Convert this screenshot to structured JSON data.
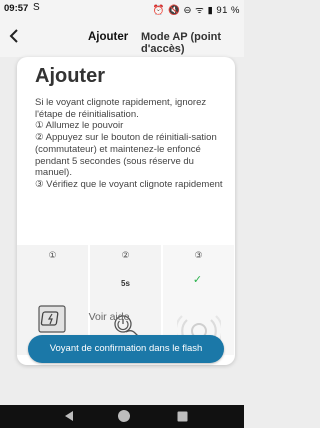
{
  "status_bar": {
    "time": "09:57",
    "app_glyph": "S",
    "system_icons": "⏰ 🔇 ⊖ ᯤ ▮ 91 %"
  },
  "header": {
    "title": "Ajouter",
    "mode_tab": "Mode AP (point d'accès)"
  },
  "card": {
    "title": "Ajouter",
    "instructions": [
      "Si le voyant clignote rapidement, ignorez l'étape de réinitialisation.",
      "① Allumez le pouvoir",
      "② Appuyez sur le bouton de réinitiali-sation (commutateur) et maintenez-le enfoncé pendant 5 secondes (sous réserve du manuel).",
      "③ Vérifiez que le voyant clignote rapidement"
    ],
    "steps": [
      {
        "number": "①",
        "icon": "power-plug-icon"
      },
      {
        "number": "②",
        "icon": "press-button-icon",
        "time": "5s"
      },
      {
        "number": "③",
        "icon": "blinking-light-icon",
        "status": "✓"
      }
    ],
    "see_help": "Voir aide"
  },
  "confirm_button": "Voyant de confirmation dans le flash",
  "colors": {
    "accent": "#1b78a8",
    "check": "#2ab24c",
    "background": "#ededed"
  }
}
